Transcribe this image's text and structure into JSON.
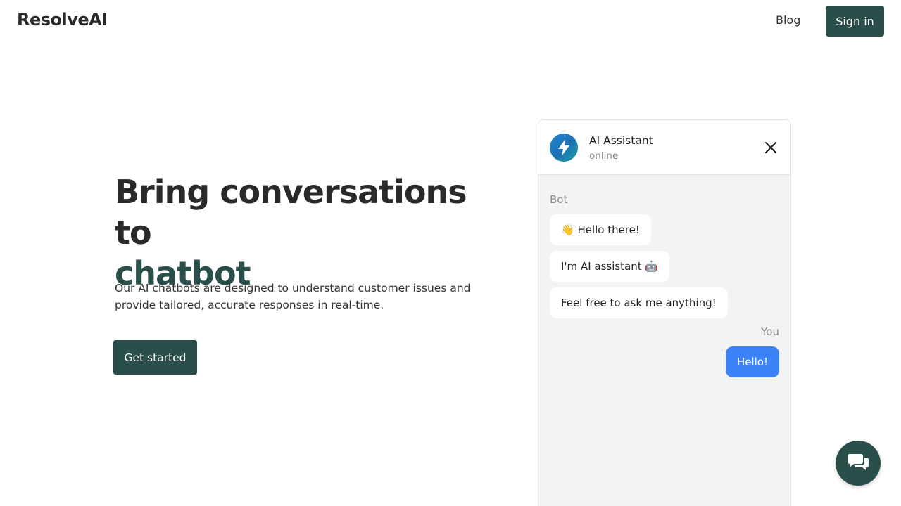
{
  "header": {
    "brand": "ResolveAI",
    "nav_blog": "Blog",
    "sign_in": "Sign in"
  },
  "hero": {
    "title_line1": "Bring conversations to",
    "title_line2": "chatbot",
    "subtitle": "Our AI chatbots are designed to understand customer issues and provide tailored, accurate responses in real-time.",
    "cta": "Get started"
  },
  "chat": {
    "bot_name": "AI Assistant",
    "status": "online",
    "bot_label": "Bot",
    "user_label": "You",
    "bot_messages": [
      "👋 Hello there!",
      "I'm AI assistant 🤖",
      "Feel free to ask me anything!"
    ],
    "user_messages": [
      "Hello!"
    ]
  },
  "icons": {
    "avatar": "lightning-icon",
    "close": "close-icon",
    "launcher": "chat-bubbles-icon"
  },
  "colors": {
    "primary": "#2a4f4a",
    "user_bubble": "#3b82f6",
    "chat_bg": "#f2f3f5"
  }
}
